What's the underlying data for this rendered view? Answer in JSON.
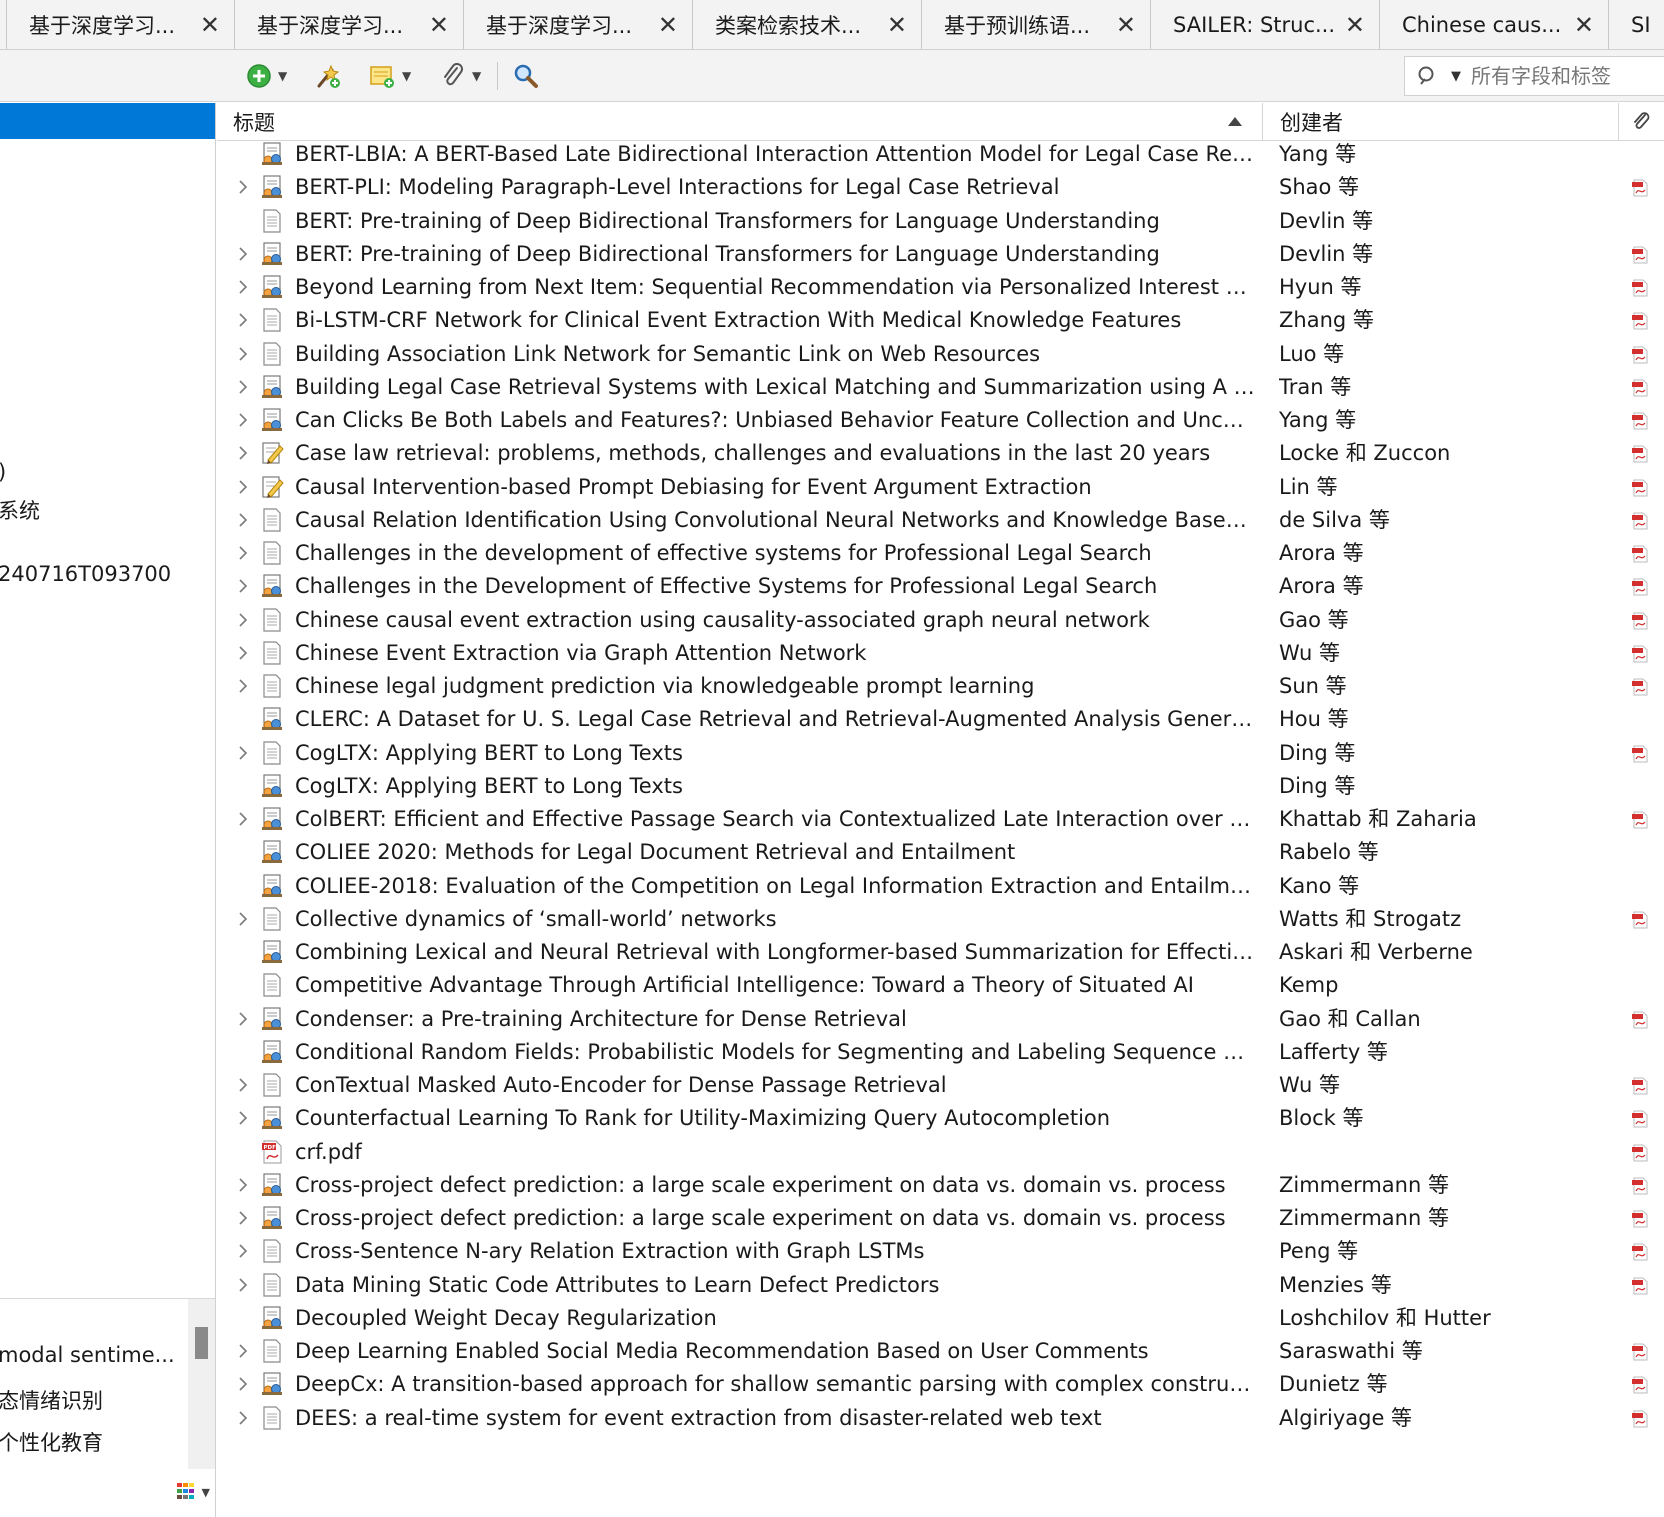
{
  "tabs": [
    {
      "label": "基于深度学习..."
    },
    {
      "label": "基于深度学习..."
    },
    {
      "label": "基于深度学习..."
    },
    {
      "label": "类案检索技术..."
    },
    {
      "label": "基于预训练语..."
    },
    {
      "label": "SAILER: Struc..."
    },
    {
      "label": "Chinese caus..."
    },
    {
      "label": "SI"
    }
  ],
  "toolbar": {
    "icons": [
      "new-item-icon",
      "add-by-identifier-icon",
      "new-note-icon",
      "add-attachment-icon",
      "advanced-search-icon"
    ]
  },
  "search": {
    "placeholder": "所有字段和标签"
  },
  "left_pane": {
    "fragments": [
      {
        "text": ")"
      },
      {
        "text": "系统"
      },
      {
        "text": "240716T093700"
      }
    ],
    "tags": [
      {
        "text": "modal sentime..."
      },
      {
        "text": "态情绪识别"
      },
      {
        "text": "个性化教育"
      }
    ]
  },
  "columns": {
    "title": "标题",
    "creator": "创建者"
  },
  "colors": {
    "selection": "#0078d7",
    "pdf_red": "#d32f2f"
  },
  "rows": [
    {
      "title": "BERT-LBIA: A BERT-Based Late Bidirectional Interaction Attention Model for Legal Case Retrie...",
      "creator": "Yang 等",
      "type": "conference-paper",
      "expandable": false,
      "pdf": false
    },
    {
      "title": "BERT-PLI: Modeling Paragraph-Level Interactions for Legal Case Retrieval",
      "creator": "Shao 等",
      "type": "conference-paper",
      "expandable": true,
      "pdf": true
    },
    {
      "title": "BERT: Pre-training of Deep Bidirectional Transformers for Language Understanding",
      "creator": "Devlin 等",
      "type": "document",
      "expandable": false,
      "pdf": false
    },
    {
      "title": "BERT: Pre-training of Deep Bidirectional Transformers for Language Understanding",
      "creator": "Devlin 等",
      "type": "conference-paper",
      "expandable": true,
      "pdf": true
    },
    {
      "title": "Beyond Learning from Next Item: Sequential Recommendation via Personalized Interest Sust...",
      "creator": "Hyun 等",
      "type": "conference-paper",
      "expandable": true,
      "pdf": true
    },
    {
      "title": "Bi-LSTM-CRF Network for Clinical Event Extraction With Medical Knowledge Features",
      "creator": "Zhang 等",
      "type": "document",
      "expandable": true,
      "pdf": true
    },
    {
      "title": "Building Association Link Network for Semantic Link on Web Resources",
      "creator": "Luo 等",
      "type": "document",
      "expandable": true,
      "pdf": true
    },
    {
      "title": "Building Legal Case Retrieval Systems with Lexical Matching and Summarization using A Pre-...",
      "creator": "Tran 等",
      "type": "conference-paper",
      "expandable": true,
      "pdf": true
    },
    {
      "title": "Can Clicks Be Both Labels and Features?: Unbiased Behavior Feature Collection and Uncertain...",
      "creator": "Yang 等",
      "type": "conference-paper",
      "expandable": true,
      "pdf": true
    },
    {
      "title": "Case law retrieval: problems, methods, challenges and evaluations in the last 20 years",
      "creator": "Locke 和 Zuccon",
      "type": "preprint",
      "expandable": true,
      "pdf": true
    },
    {
      "title": "Causal Intervention-based Prompt Debiasing for Event Argument Extraction",
      "creator": "Lin 等",
      "type": "preprint",
      "expandable": true,
      "pdf": true
    },
    {
      "title": "Causal Relation Identification Using Convolutional Neural Networks and Knowledge Based Fe...",
      "creator": "de Silva 等",
      "type": "document",
      "expandable": true,
      "pdf": true
    },
    {
      "title": "Challenges in the development of effective systems for Professional Legal Search",
      "creator": "Arora 等",
      "type": "document",
      "expandable": true,
      "pdf": true
    },
    {
      "title": "Challenges in the Development of Effective Systems for Professional Legal Search",
      "creator": "Arora 等",
      "type": "conference-paper",
      "expandable": true,
      "pdf": true
    },
    {
      "title": "Chinese causal event extraction using causality-associated graph neural network",
      "creator": "Gao 等",
      "type": "document",
      "expandable": true,
      "pdf": true
    },
    {
      "title": "Chinese Event Extraction via Graph Attention Network",
      "creator": "Wu 等",
      "type": "document",
      "expandable": true,
      "pdf": true
    },
    {
      "title": "Chinese legal judgment prediction via knowledgeable prompt learning",
      "creator": "Sun 等",
      "type": "document",
      "expandable": true,
      "pdf": true
    },
    {
      "title": "CLERC: A Dataset for U. S. Legal Case Retrieval and Retrieval-Augmented Analysis Generation",
      "creator": "Hou 等",
      "type": "conference-paper",
      "expandable": false,
      "pdf": false
    },
    {
      "title": "CogLTX: Applying BERT to Long Texts",
      "creator": "Ding 等",
      "type": "document",
      "expandable": true,
      "pdf": true
    },
    {
      "title": "CogLTX: Applying BERT to Long Texts",
      "creator": "Ding 等",
      "type": "conference-paper",
      "expandable": false,
      "pdf": false
    },
    {
      "title": "ColBERT: Efficient and Effective Passage Search via Contextualized Late Interaction over BERT",
      "creator": "Khattab 和 Zaharia",
      "type": "conference-paper",
      "expandable": true,
      "pdf": true
    },
    {
      "title": "COLIEE 2020: Methods for Legal Document Retrieval and Entailment",
      "creator": "Rabelo 等",
      "type": "conference-paper",
      "expandable": false,
      "pdf": false
    },
    {
      "title": "COLIEE-2018: Evaluation of the Competition on Legal Information Extraction and Entailment",
      "creator": "Kano 等",
      "type": "conference-paper",
      "expandable": false,
      "pdf": false
    },
    {
      "title": "Collective dynamics of ‘small-world’ networks",
      "creator": "Watts 和 Strogatz",
      "type": "document",
      "expandable": true,
      "pdf": true
    },
    {
      "title": "Combining Lexical and Neural Retrieval with Longformer-based Summarization for Effective ...",
      "creator": "Askari 和 Verberne",
      "type": "conference-paper",
      "expandable": false,
      "pdf": false
    },
    {
      "title": "Competitive Advantage Through Artificial Intelligence: Toward a Theory of Situated AI",
      "creator": "Kemp",
      "type": "document",
      "expandable": false,
      "pdf": false
    },
    {
      "title": "Condenser: a Pre-training Architecture for Dense Retrieval",
      "creator": "Gao 和 Callan",
      "type": "conference-paper",
      "expandable": true,
      "pdf": true
    },
    {
      "title": "Conditional Random Fields: Probabilistic Models for Segmenting and Labeling Sequence Data",
      "creator": "Lafferty 等",
      "type": "conference-paper",
      "expandable": false,
      "pdf": false
    },
    {
      "title": "ConTextual Masked Auto-Encoder for Dense Passage Retrieval",
      "creator": "Wu 等",
      "type": "document",
      "expandable": true,
      "pdf": true
    },
    {
      "title": "Counterfactual Learning To Rank for Utility-Maximizing Query Autocompletion",
      "creator": "Block 等",
      "type": "conference-paper",
      "expandable": true,
      "pdf": true
    },
    {
      "title": "crf.pdf",
      "creator": "",
      "type": "pdf",
      "expandable": false,
      "pdf": true
    },
    {
      "title": "Cross-project defect prediction: a large scale experiment on data vs. domain vs. process",
      "creator": "Zimmermann 等",
      "type": "conference-paper",
      "expandable": true,
      "pdf": true
    },
    {
      "title": "Cross-project defect prediction: a large scale experiment on data vs. domain vs. process",
      "creator": "Zimmermann 等",
      "type": "conference-paper",
      "expandable": true,
      "pdf": true
    },
    {
      "title": "Cross-Sentence N-ary Relation Extraction with Graph LSTMs",
      "creator": "Peng 等",
      "type": "document",
      "expandable": true,
      "pdf": true
    },
    {
      "title": "Data Mining Static Code Attributes to Learn Defect Predictors",
      "creator": "Menzies 等",
      "type": "document",
      "expandable": true,
      "pdf": true
    },
    {
      "title": "Decoupled Weight Decay Regularization",
      "creator": "Loshchilov 和 Hutter",
      "type": "conference-paper",
      "expandable": false,
      "pdf": false
    },
    {
      "title": "Deep Learning Enabled Social Media Recommendation Based on User Comments",
      "creator": "Saraswathi 等",
      "type": "document",
      "expandable": true,
      "pdf": true
    },
    {
      "title": "DeepCx: A transition-based approach for shallow semantic parsing with complex constructio...",
      "creator": "Dunietz 等",
      "type": "conference-paper",
      "expandable": true,
      "pdf": true
    },
    {
      "title": "DEES: a real-time system for event extraction from disaster-related web text",
      "creator": "Algiriyage 等",
      "type": "document",
      "expandable": true,
      "pdf": true
    }
  ]
}
